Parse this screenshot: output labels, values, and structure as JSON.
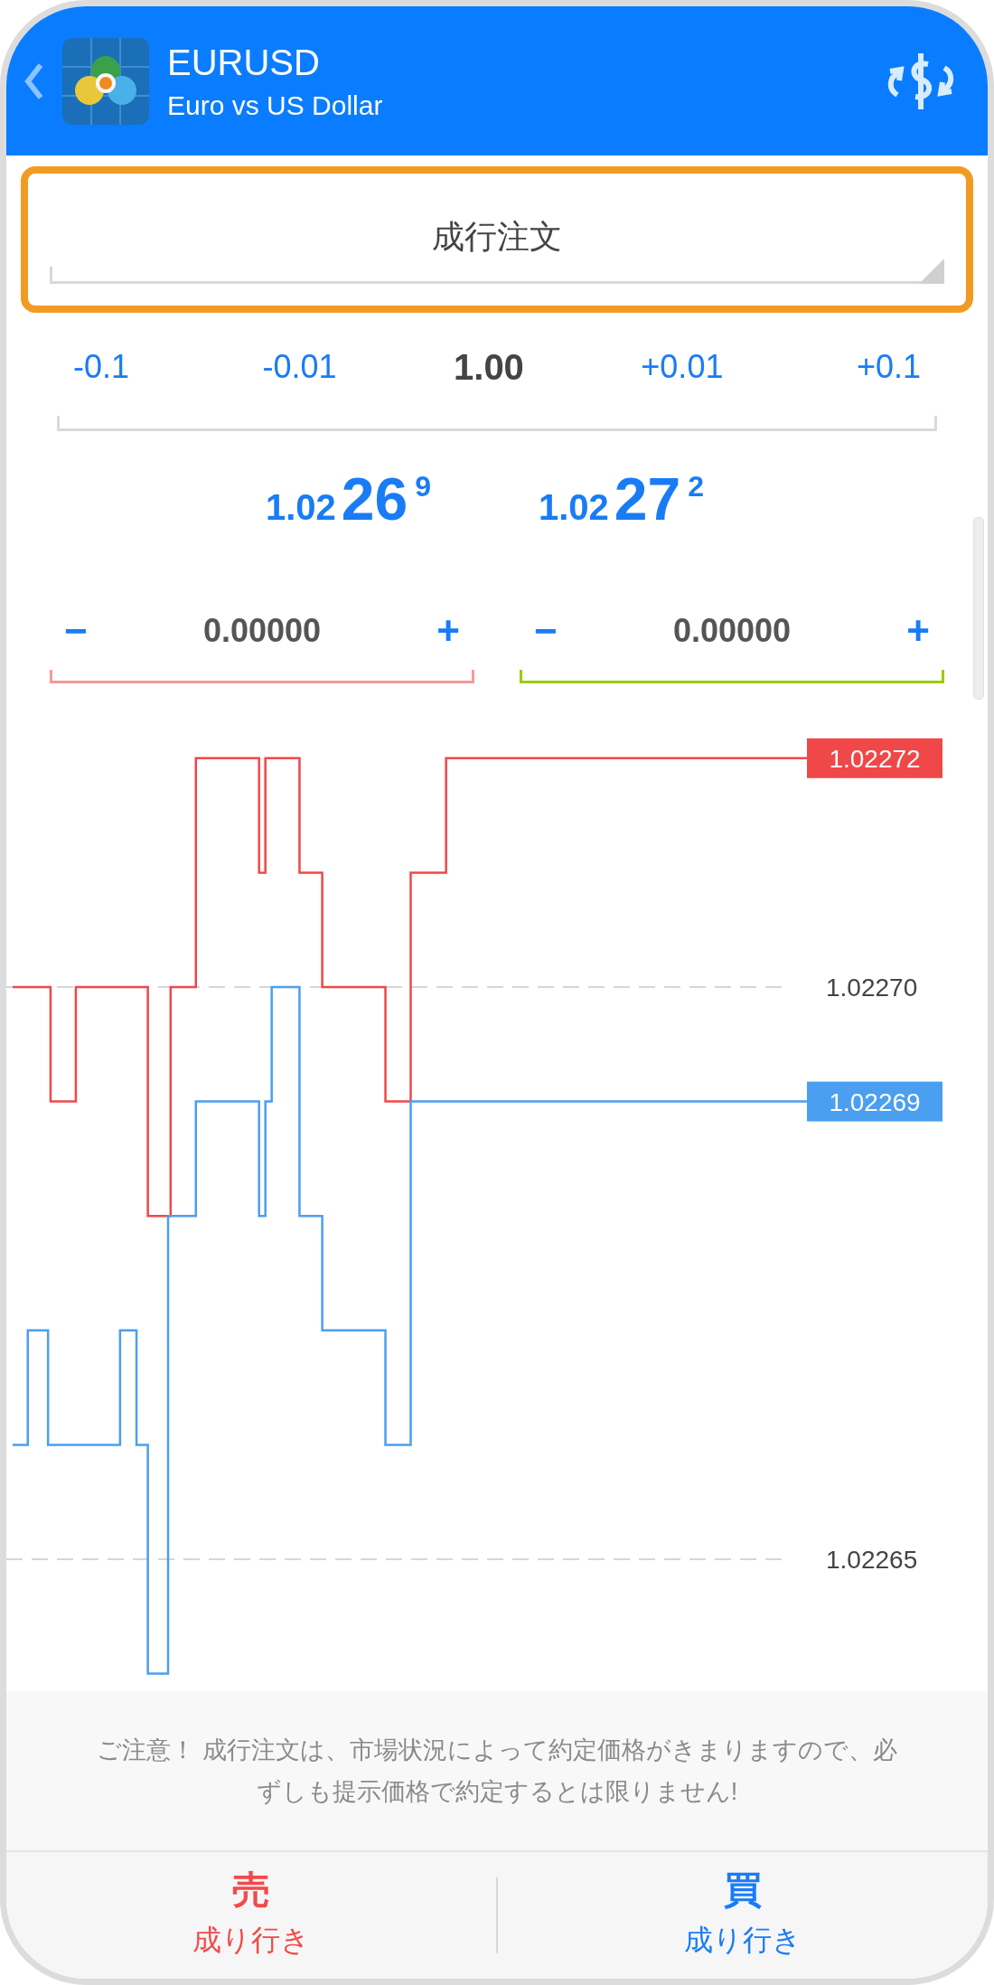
{
  "header": {
    "symbol": "EURUSD",
    "description": "Euro vs US Dollar"
  },
  "order_type": {
    "value": "成行注文",
    "highlighted": true
  },
  "volume": {
    "steps_down": [
      "-0.1",
      "-0.01"
    ],
    "value": "1.00",
    "steps_up": [
      "+0.01",
      "+0.1"
    ]
  },
  "quotes": [
    {
      "prefix": "1.02",
      "digits": "26",
      "pip": "9"
    },
    {
      "prefix": "1.02",
      "digits": "27",
      "pip": "2"
    }
  ],
  "levels": [
    {
      "kind": "stop_loss",
      "minus": "−",
      "value": "0.00000",
      "plus": "+"
    },
    {
      "kind": "take_profit",
      "minus": "−",
      "value": "0.00000",
      "plus": "+"
    }
  ],
  "chart": {
    "grid_labels": [
      "1.02270",
      "1.02265"
    ],
    "price_tags": [
      {
        "kind": "ask",
        "text": "1.02272"
      },
      {
        "kind": "bid",
        "text": "1.02269"
      }
    ]
  },
  "notice": "ご注意！ 成行注文は、市場状況によって約定価格がきまりますので、必ずしも提示価格で約定するとは限りません!",
  "actions": [
    {
      "kind": "sell",
      "title": "売",
      "label": "成り行き"
    },
    {
      "kind": "buy",
      "title": "買",
      "label": "成り行き"
    }
  ]
}
